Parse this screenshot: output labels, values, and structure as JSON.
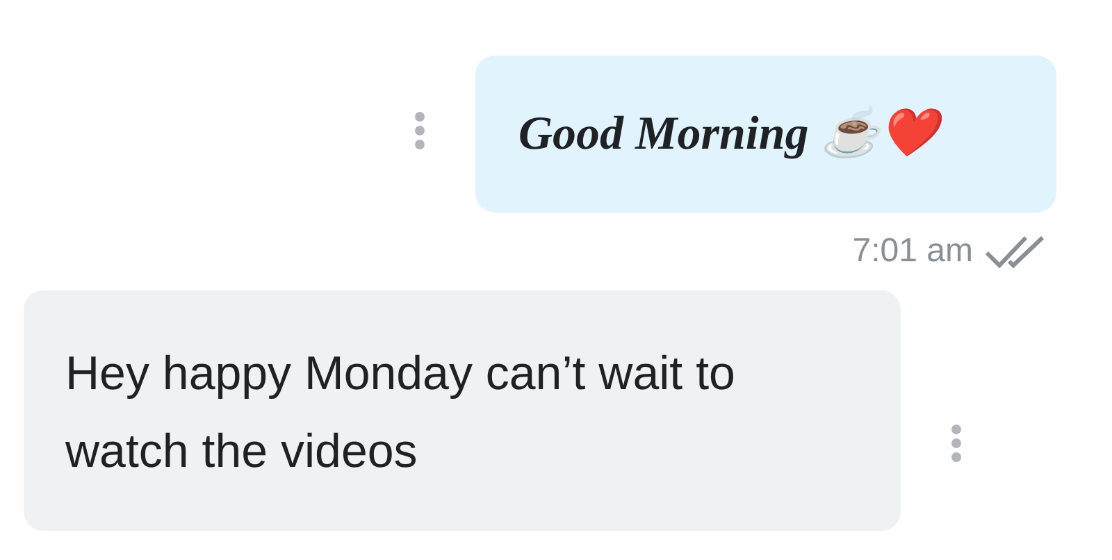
{
  "messages": [
    {
      "outgoing": true,
      "text": "Good Morning ☕❤️",
      "time": "7:01 am",
      "read": true
    },
    {
      "outgoing": false,
      "text": "Hey happy Monday can’t wait to watch the videos"
    }
  ]
}
